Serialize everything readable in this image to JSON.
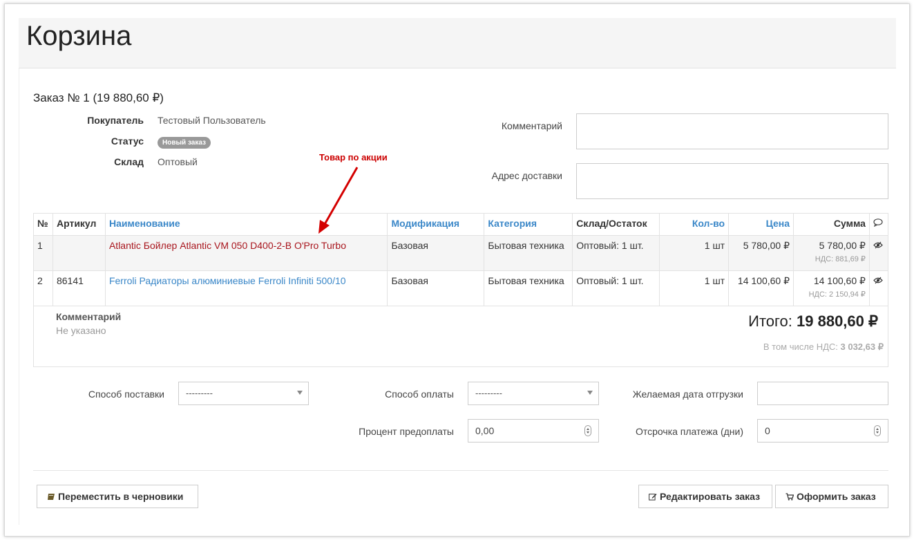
{
  "page": {
    "title": "Корзина"
  },
  "order": {
    "title": "Заказ № 1 (19 880,60 ₽)",
    "buyer_label": "Покупатель",
    "buyer_value": "Тестовый Пользователь",
    "status_label": "Статус",
    "status_value": "Новый заказ",
    "warehouse_label": "Склад",
    "warehouse_value": "Оптовый",
    "comment_label": "Комментарий",
    "address_label": "Адрес доставки"
  },
  "annotation": {
    "promo": "Товар по акции"
  },
  "table": {
    "headers": [
      "№",
      "Артикул",
      "Наименование",
      "Модификация",
      "Категория",
      "Склад/Остаток",
      "Кол-во",
      "Цена",
      "Сумма"
    ],
    "rows": [
      {
        "num": "1",
        "sku": "",
        "name": "Atlantic Бойлер Atlantic VM 050 D400-2-B O'Pro Turbo",
        "mod": "Базовая",
        "category": "Бытовая техника",
        "stock": "Оптовый: 1 шт.",
        "qty": "1 шт",
        "price": "5 780,00 ₽",
        "sum": "5 780,00 ₽",
        "vat": "НДС: 881,69 ₽"
      },
      {
        "num": "2",
        "sku": "86141",
        "name": "Ferroli Радиаторы алюминиевые Ferroli Infiniti 500/10",
        "mod": "Базовая",
        "category": "Бытовая техника",
        "stock": "Оптовый: 1 шт.",
        "qty": "1 шт",
        "price": "14 100,60 ₽",
        "sum": "14 100,60 ₽",
        "vat": "НДС: 2 150,94 ₽"
      }
    ]
  },
  "summary": {
    "comment_label": "Комментарий",
    "comment_value": "Не указано",
    "total_label": "Итого: ",
    "total_value": "19 880,60 ₽",
    "vat_label": "В том числе НДС: ",
    "vat_value": "3 032,63 ₽"
  },
  "form": {
    "delivery_label": "Способ поставки",
    "delivery_value": "---------",
    "payment_label": "Способ оплаты",
    "payment_value": "---------",
    "ship_date_label": "Желаемая дата отгрузки",
    "ship_date_value": "",
    "prepay_label": "Процент предоплаты",
    "prepay_value": "0,00",
    "deferral_label": "Отсрочка платежа (дни)",
    "deferral_value": "0"
  },
  "buttons": {
    "drafts": "Переместить в черновики",
    "edit": "Редактировать заказ",
    "checkout": "Оформить заказ"
  },
  "colors": {
    "link": "#3a87c8",
    "promo": "#a8141c",
    "annotation": "#cc0000"
  }
}
